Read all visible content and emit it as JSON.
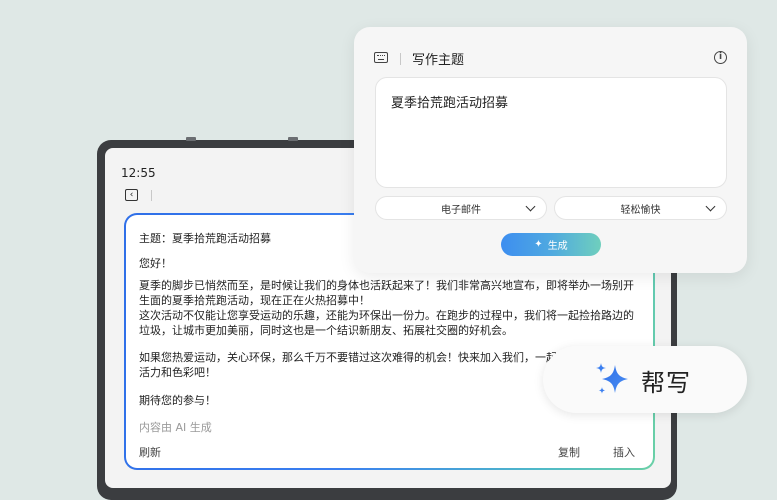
{
  "status": {
    "time": "12:55"
  },
  "draft": {
    "subject": "主题：夏季拾荒跑活动招募",
    "greeting": "您好！",
    "para1": [
      "夏季的脚步已悄然而至，是时候让我们的身体也活跃起来了！我们非常高兴地宣布，即将举办一场别开",
      "生面的夏季拾荒跑活动，现在正在火热招募中！",
      "这次活动不仅能让您享受运动的乐趣，还能为环保出一份力。在跑步的过程中，我们将一起捡拾路边的",
      "垃圾，让城市更加美丽，同时这也是一个结识新朋友、拓展社交圈的好机会。"
    ],
    "para2": [
      "如果您热爱运动，关心环保，那么千万不要错过这次难得的机会！快来加入我们，一起",
      "活力和色彩吧！"
    ],
    "closing": "期待您的参与！",
    "ai_note": "内容由 AI 生成",
    "refresh_label": "刷新",
    "copy_label": "复制",
    "insert_label": "插入"
  },
  "topic_panel": {
    "title": "写作主题",
    "input_value": "夏季拾荒跑活动招募",
    "format_select": "电子邮件",
    "tone_select": "轻松愉快",
    "generate_label": "生成"
  },
  "help_write": {
    "label": "帮写"
  },
  "icons": {
    "keyboard": "keyboard-icon",
    "info": "info-icon",
    "back": "back-icon",
    "sparkle": "sparkle-icon"
  },
  "colors": {
    "accent_blue": "#2f6fe8",
    "accent_teal": "#6ad0a6",
    "background": "#dfe8e6"
  }
}
